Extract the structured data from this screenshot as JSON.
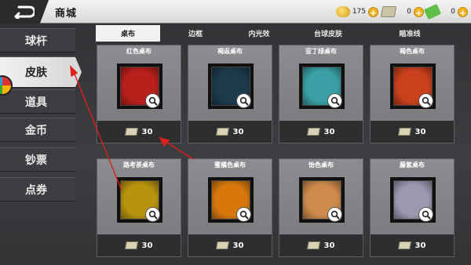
{
  "header": {
    "title": "商城"
  },
  "currencies": [
    {
      "name": "coin",
      "value": "175",
      "color": "#e8b22a"
    },
    {
      "name": "cash",
      "value": "0",
      "color": "#b6b09a"
    },
    {
      "name": "ticket",
      "value": "0",
      "color": "#5fbf4a"
    }
  ],
  "sidebar": {
    "items": [
      {
        "label": "球杆"
      },
      {
        "label": "皮肤"
      },
      {
        "label": "道具"
      },
      {
        "label": "金币"
      },
      {
        "label": "钞票"
      },
      {
        "label": "点券"
      }
    ],
    "active_index": 1
  },
  "tabs": [
    {
      "label": "桌布"
    },
    {
      "label": "边框"
    },
    {
      "label": "内光效"
    },
    {
      "label": "台球皮肤"
    },
    {
      "label": "瞄准线"
    }
  ],
  "active_tab": 0,
  "items": [
    {
      "name": "红色桌布",
      "price": "30",
      "color": "#b8201c"
    },
    {
      "name": "褐返桌布",
      "price": "30",
      "color": "#1c3a4c"
    },
    {
      "name": "亚丁绿桌布",
      "price": "30",
      "color": "#3aa0a6"
    },
    {
      "name": "褐色桌布",
      "price": "30",
      "color": "#c9401c"
    },
    {
      "name": "路考茶桌布",
      "price": "30",
      "color": "#b8940e"
    },
    {
      "name": "蜜橘色桌布",
      "price": "30",
      "color": "#d8780c"
    },
    {
      "name": "饴色桌布",
      "price": "30",
      "color": "#cd8a4c"
    },
    {
      "name": "藤紫桌布",
      "price": "30",
      "color": "#9c98b0"
    }
  ]
}
